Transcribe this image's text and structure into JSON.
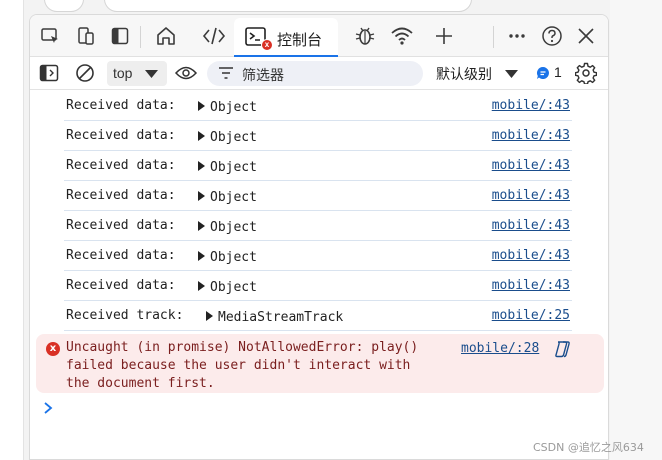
{
  "devtools": {
    "tabs": {
      "console_label": "控制台",
      "icons": [
        "inspect-icon",
        "device-emulation-icon",
        "dock-icon",
        "welcome-home-icon",
        "elements-icon",
        "console-icon",
        "sources-bug-icon",
        "network-wifi-icon",
        "add-tab-icon",
        "more-icon",
        "help-icon",
        "close-icon"
      ],
      "console_badge": "x"
    },
    "toolbar": {
      "context_value": "top",
      "filter_placeholder": "筛选器",
      "levels_label": "默认级别",
      "message_count": "1"
    },
    "console": {
      "logs": [
        {
          "text": "Received data:",
          "object": "Object",
          "source": "mobile/:43"
        },
        {
          "text": "Received data:",
          "object": "Object",
          "source": "mobile/:43"
        },
        {
          "text": "Received data:",
          "object": "Object",
          "source": "mobile/:43"
        },
        {
          "text": "Received data:",
          "object": "Object",
          "source": "mobile/:43"
        },
        {
          "text": "Received data:",
          "object": "Object",
          "source": "mobile/:43"
        },
        {
          "text": "Received data:",
          "object": "Object",
          "source": "mobile/:43"
        },
        {
          "text": "Received data:",
          "object": "Object",
          "source": "mobile/:43"
        },
        {
          "text": "Received track:",
          "object": "MediaStreamTrack",
          "source": "mobile/:25"
        }
      ],
      "error": {
        "icon": "x",
        "lines": [
          "Uncaught (in promise) NotAllowedError: play()",
          "failed because the user didn't interact with",
          "the document first."
        ],
        "source": "mobile/:28"
      },
      "prompt": "›"
    }
  },
  "watermark": "CSDN @追忆之风634",
  "colors": {
    "accent": "#1a73e8",
    "error_bg": "#fcebeb",
    "error_icon": "#d93025",
    "link": "#1a4d8c",
    "row_divider": "#d9e3ef"
  }
}
